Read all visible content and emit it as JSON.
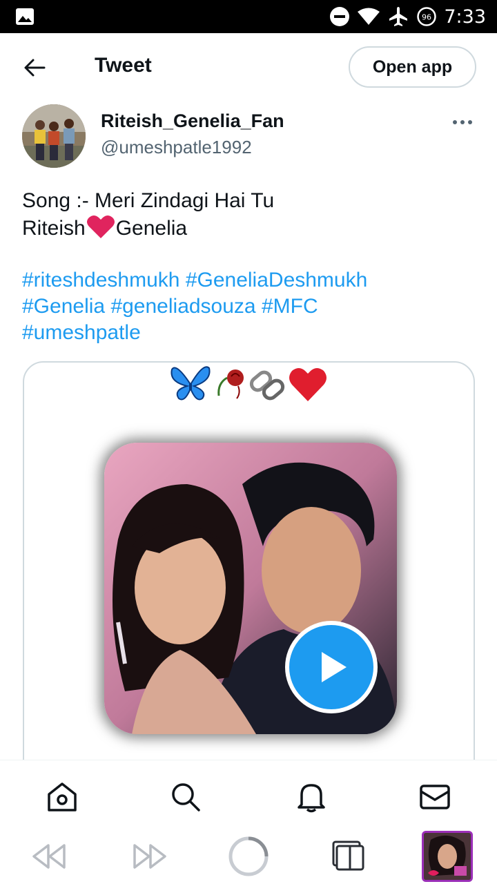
{
  "status_bar": {
    "time": "7:33",
    "battery_level": "96",
    "icons": [
      "image-icon",
      "do-not-disturb-icon",
      "wifi-icon",
      "airplane-icon",
      "battery-icon"
    ]
  },
  "header": {
    "title": "Tweet",
    "open_app_label": "Open app"
  },
  "author": {
    "name": "Riteish_Genelia_Fan",
    "handle": "@umeshpatle1992"
  },
  "tweet": {
    "line1": "Song :- Meri Zindagi Hai Tu",
    "line2_before": "Riteish",
    "line2_after": "Genelia",
    "hashtags": {
      "h1": "#riteshdeshmukh",
      "h2": "#GeneliaDeshmukh",
      "h3": "#Genelia",
      "h4": "#geneliadsouza",
      "h5": "#MFC",
      "h6": "#umeshpatle"
    }
  },
  "media": {
    "emoji_row": [
      "butterfly",
      "wilted-rose",
      "chain-links",
      "red-heart"
    ],
    "play_icon": "play-icon"
  },
  "bottom_nav": [
    "home-icon",
    "search-icon",
    "notifications-icon",
    "messages-icon"
  ],
  "browser_toolbar": [
    "back-icon",
    "forward-icon",
    "loading-icon",
    "tabs-icon",
    "tab-thumbnail"
  ],
  "colors": {
    "accent": "#1d9bf0",
    "text": "#0f1419",
    "muted": "#536471",
    "border": "#cfd9de",
    "heart": "#e0245e",
    "tab_border": "#9b2fb8"
  }
}
